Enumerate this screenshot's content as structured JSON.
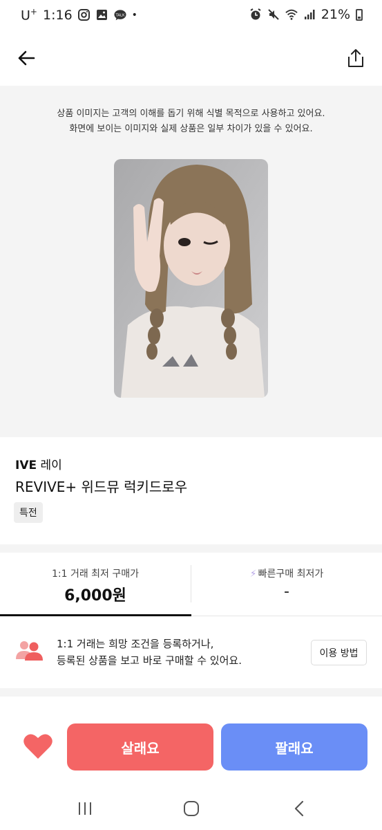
{
  "status_bar": {
    "carrier": "U",
    "carrier_sup": "+",
    "time": "1:16",
    "dot": "•",
    "battery": "21%"
  },
  "header": {
    "back_icon": "arrow-left-icon",
    "share_icon": "share-icon"
  },
  "image_area": {
    "notice_line1": "상품 이미지는 고객의 이해를 돕기 위해 식별 목적으로 사용하고 있어요.",
    "notice_line2": "화면에 보이는 이미지와 실제 상품은 일부 차이가 있을 수 있어요."
  },
  "product": {
    "brand": "IVE",
    "member": "레이",
    "name": "REVIVE+ 위드뮤 럭키드로우",
    "tag": "특전"
  },
  "price": {
    "left_label": "1:1 거래 최저 구매가",
    "left_value": "6,000원",
    "right_label": "빠른구매 최저가",
    "right_value": "-"
  },
  "info_banner": {
    "line1": "1:1 거래는 희망 조건을 등록하거나,",
    "line2": "등록된 상품을 보고 바로 구매할 수 있어요.",
    "button": "이용 방법"
  },
  "actions": {
    "buy": "살래요",
    "sell": "팔래요"
  },
  "colors": {
    "buy": "#f46565",
    "sell": "#6a8ef6",
    "heart": "#f46565"
  }
}
